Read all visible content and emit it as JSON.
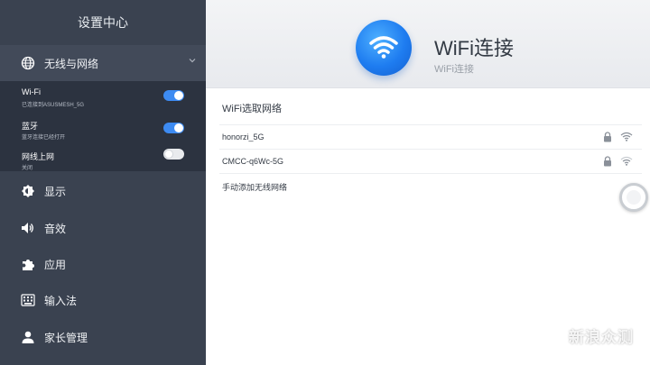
{
  "sidebar": {
    "title": "设置中心",
    "group": {
      "label": "无线与网络",
      "icon": "globe-icon",
      "expanded": true
    },
    "subitems": [
      {
        "title": "Wi-Fi",
        "subtitle": "已连接到ASUSMESH_5G",
        "toggle": true
      },
      {
        "title": "蓝牙",
        "subtitle": "蓝牙连接已经打开",
        "toggle": true
      },
      {
        "title": "网线上网",
        "subtitle": "关闭",
        "toggle": false
      }
    ],
    "items": [
      {
        "label": "显示",
        "icon": "brightness-icon"
      },
      {
        "label": "音效",
        "icon": "speaker-icon"
      },
      {
        "label": "应用",
        "icon": "puzzle-icon"
      },
      {
        "label": "输入法",
        "icon": "keyboard-icon"
      },
      {
        "label": "家长管理",
        "icon": "person-icon"
      }
    ]
  },
  "main": {
    "banner": {
      "title": "WiFi连接",
      "subtitle": "WiFi连接",
      "icon": "wifi-icon"
    },
    "section_title": "WiFi选取网络",
    "networks": [
      {
        "name": "honorzi_5G",
        "locked": true,
        "signal": "strong"
      },
      {
        "name": "CMCC-q6Wc-5G",
        "locked": true,
        "signal": "medium"
      }
    ],
    "add_network_label": "手动添加无线网络"
  },
  "watermark": "新浪众测",
  "colors": {
    "sidebar": "#3a4250",
    "accent": "#3d8bf2"
  }
}
